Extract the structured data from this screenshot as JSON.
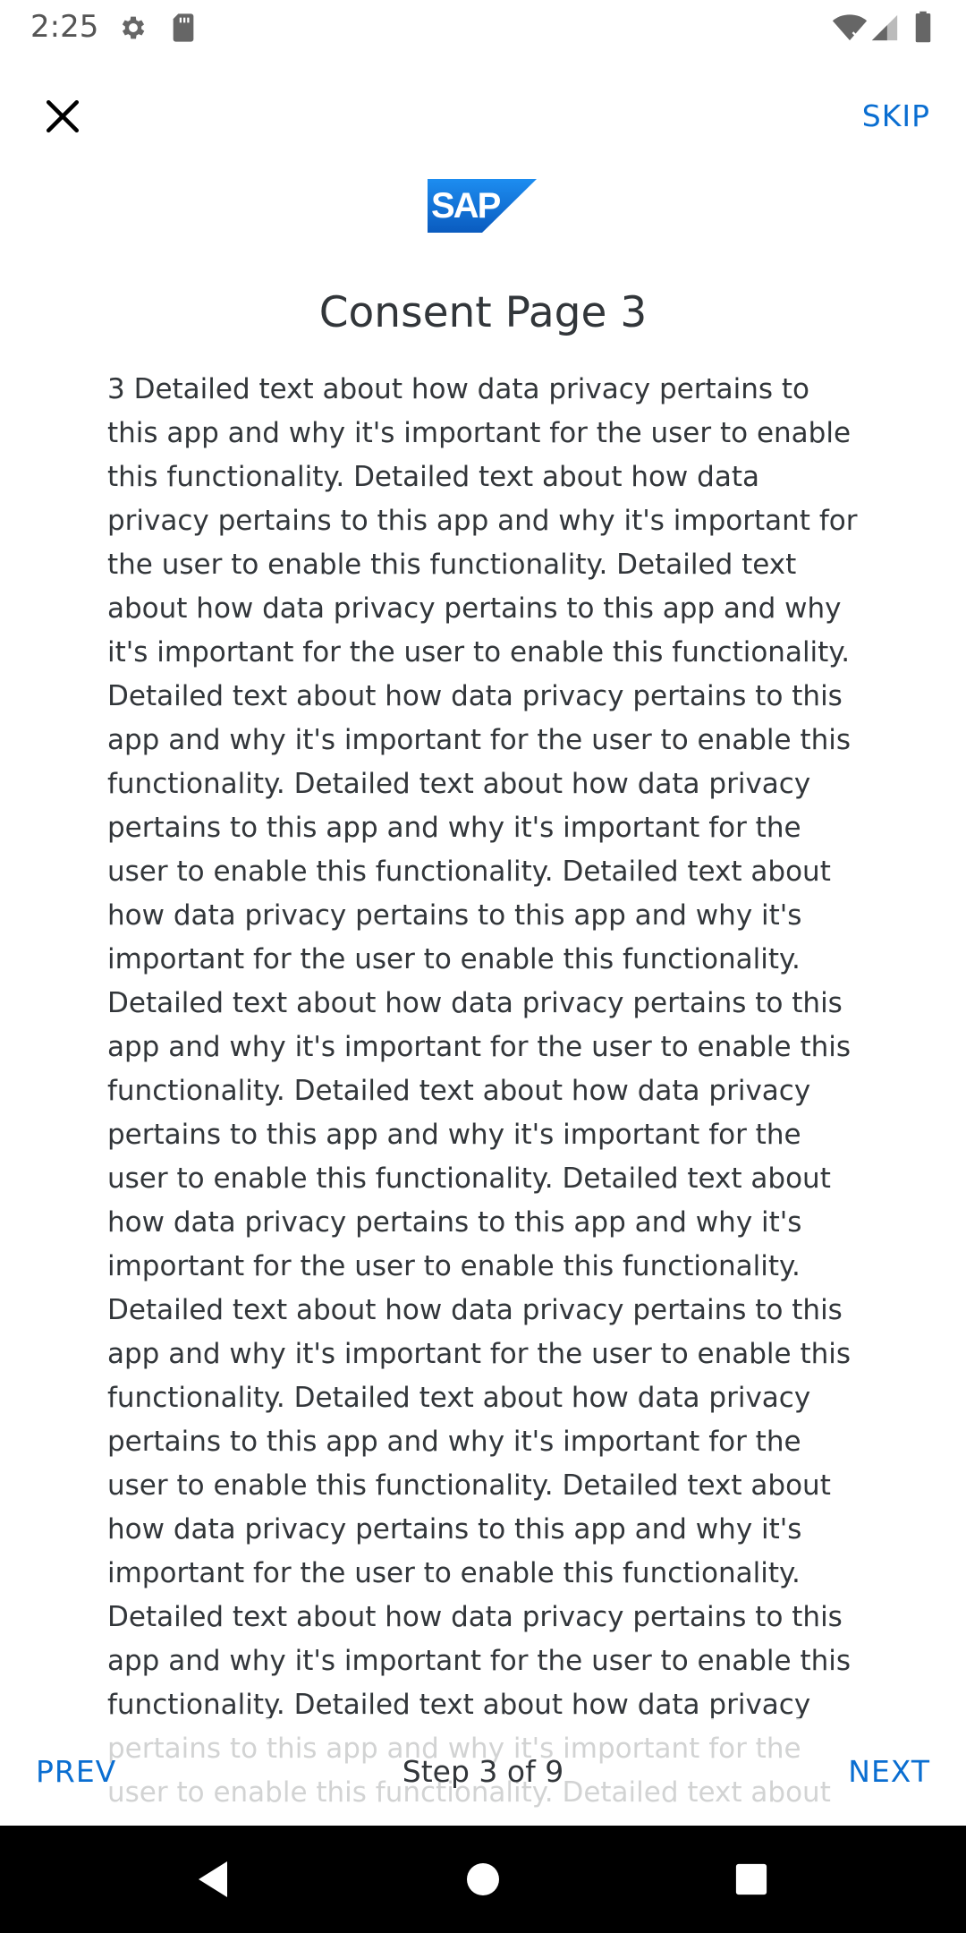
{
  "status_bar": {
    "time": "2:25",
    "icons": [
      "settings-icon",
      "sd-card-icon",
      "wifi-no-internet-icon",
      "cellular-signal-icon",
      "battery-icon"
    ]
  },
  "header": {
    "close_icon": "close-icon",
    "skip_label": "SKIP"
  },
  "logo": {
    "text": "SAP",
    "color": "#0a6ed1"
  },
  "page": {
    "title": "Consent Page 3",
    "body": "3 Detailed text about how data privacy pertains to this app and why it's important for the user to enable this functionality. Detailed text about how data privacy pertains to this app and why it's important for the user to enable this functionality. Detailed text about how data privacy pertains to this app and why it's important for the user to enable this functionality. Detailed text about how data privacy pertains to this app and why it's important for the user to enable this functionality. Detailed text about how data privacy pertains to this app and why it's important for the user to enable this functionality. Detailed text about how data privacy pertains to this app and why it's important for the user to enable this functionality. Detailed text about how data privacy pertains to this app and why it's important for the user to enable this functionality. Detailed text about how data privacy pertains to this app and why it's important for the user to enable this functionality. Detailed text about how data privacy pertains to this app and why it's important for the user to enable this functionality. Detailed text about how data privacy pertains to this app and why it's important for the user to enable this functionality. Detailed text about how data privacy pertains to this app and why it's important for the user to enable this functionality. Detailed text about how data privacy pertains to this app and why it's important for the user to enable this functionality. Detailed text about how data privacy pertains to this app and why it's important for the user to enable this functionality. Detailed text about how data privacy pertains to this app and why it's important for the user to enable this functionality. Detailed text about"
  },
  "wizard": {
    "prev_label": "PREV",
    "step_label": "Step 3 of 9",
    "next_label": "NEXT"
  },
  "nav_bar": {
    "icons": [
      "back-icon",
      "home-icon",
      "recents-icon"
    ]
  },
  "colors": {
    "accent": "#0a6ed1",
    "text": "#32363a",
    "nav_bar": "#000000"
  }
}
